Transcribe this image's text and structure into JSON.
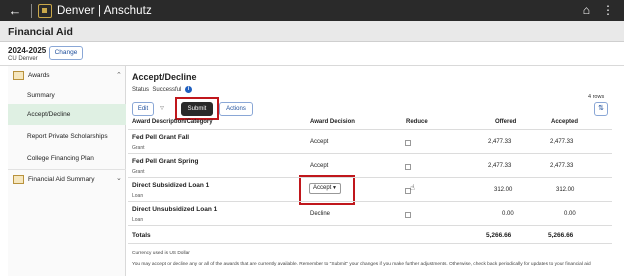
{
  "topbar": {
    "back_icon": "back-arrow-icon",
    "brand": "Denver | Anschutz",
    "home_icon": "home-icon",
    "more_icon": "more-icon"
  },
  "page": {
    "title": "Financial Aid"
  },
  "aid_year": {
    "year": "2024-2025",
    "campus": "CU Denver",
    "change_label": "Change"
  },
  "sidebar": {
    "items": [
      {
        "label": "Awards",
        "icon": "awards-icon"
      },
      {
        "label": "Summary"
      },
      {
        "label": "Accept/Decline",
        "selected": true
      },
      {
        "label": "Report Private Scholarships"
      },
      {
        "label": "College Financing Plan"
      },
      {
        "label": "Financial Aid Summary",
        "icon": "summary-icon"
      }
    ]
  },
  "main": {
    "title": "Accept/Decline",
    "status_label": "Status",
    "status_value": "Successful",
    "rows_count": "4 rows",
    "buttons": {
      "edit": "Edit",
      "submit": "Submit",
      "actions": "Actions"
    }
  },
  "table": {
    "headers": {
      "category": "Award Description/Category",
      "decision": "Award Decision",
      "reduce": "Reduce",
      "offered": "Offered",
      "accepted": "Accepted"
    },
    "rows": [
      {
        "name": "Fed Pell Grant Fall",
        "category": "Grant",
        "decision": "Accept",
        "offered": "2,477.33",
        "accepted": "2,477.33"
      },
      {
        "name": "Fed Pell Grant Spring",
        "category": "Grant",
        "decision": "Accept",
        "offered": "2,477.33",
        "accepted": "2,477.33"
      },
      {
        "name": "Direct Subsidized Loan 1",
        "category": "Loan",
        "decision": "Accept",
        "offered": "312.00",
        "accepted": "312.00"
      },
      {
        "name": "Direct Unsubsidized Loan 1",
        "category": "Loan",
        "decision": "Decline",
        "offered": "0.00",
        "accepted": "0.00"
      }
    ],
    "totals": {
      "label": "Totals",
      "offered": "5,266.66",
      "accepted": "5,266.66"
    }
  },
  "footnotes": {
    "currency": "Currency used is US Dollar",
    "note": "You may accept or decline any or all of the awards that are currently available. Remember to \"Submit\" your changes if you make further adjustments. Otherwise, check back periodically for updates to your financial aid"
  },
  "colors": {
    "accent": "#1f4f9c",
    "highlight": "#c0171c",
    "selected_bg": "#dff0e3",
    "topbar": "#2a2a2a"
  }
}
